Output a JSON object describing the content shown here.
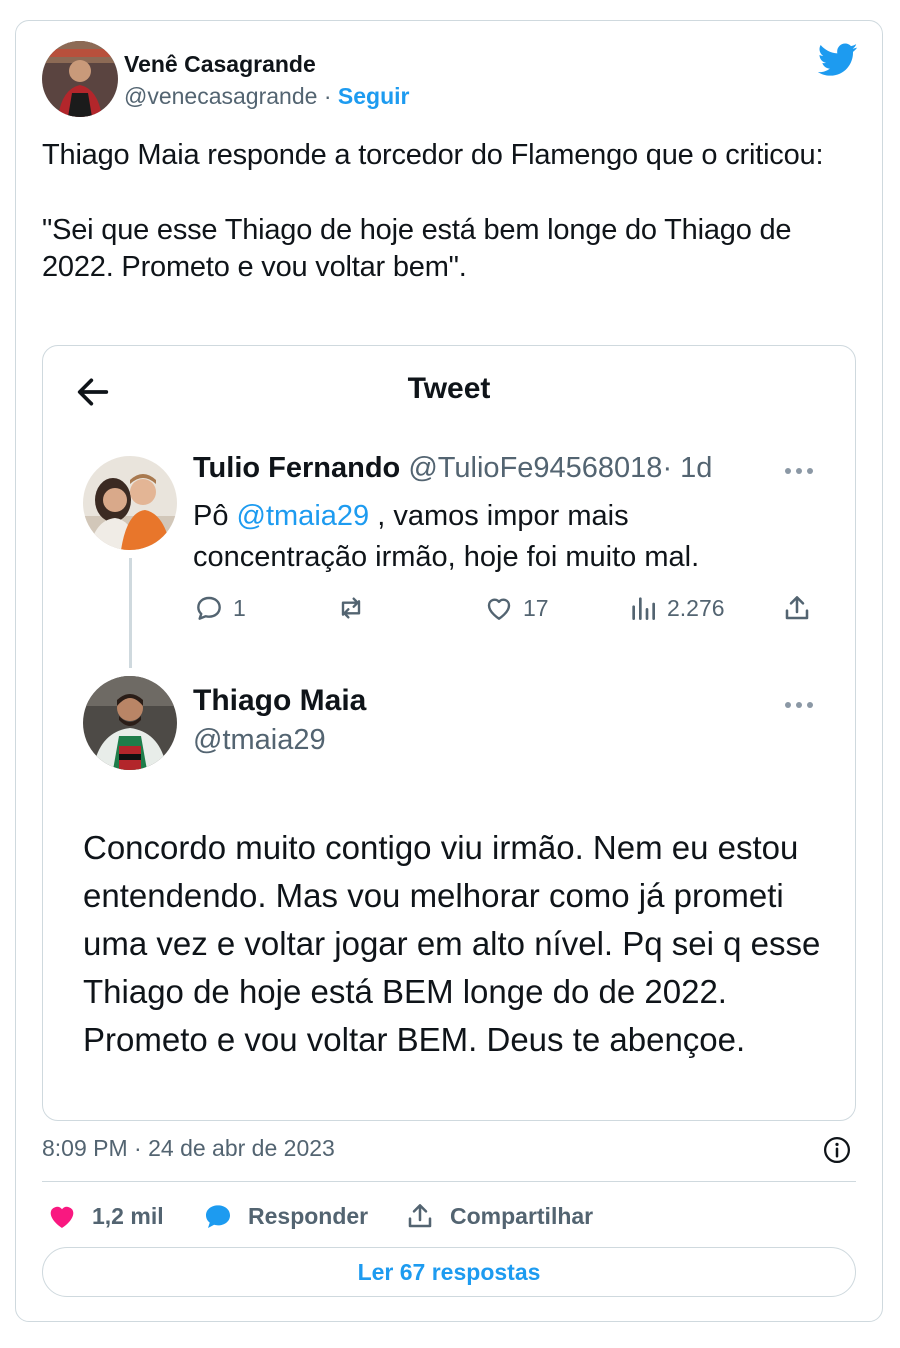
{
  "author": {
    "name": "Venê Casagrande",
    "handle": "@venecasagrande",
    "separator": "·",
    "follow_label": "Seguir"
  },
  "tweet": {
    "paragraphs": [
      "Thiago Maia responde a torcedor do Flamengo que o criticou:",
      "\"Sei que esse Thiago de hoje está bem longe do Thiago de 2022. Prometo e vou voltar bem\"."
    ]
  },
  "embed": {
    "title": "Tweet",
    "reply_tweet": {
      "name": "Tulio Fernando",
      "handle": "@TulioFe94568018",
      "time": "· 1d",
      "text_before": "Pô ",
      "mention": "@tmaia29",
      "text_after": " , vamos impor mais concentração irmão,  hoje foi muito mal.",
      "stats": {
        "replies": "1",
        "retweets": "",
        "likes": "17",
        "views": "2.276"
      }
    },
    "main_tweet": {
      "name": "Thiago Maia",
      "handle": "@tmaia29",
      "text": "Concordo muito contigo viu irmão. Nem eu estou entendendo. Mas vou melhorar como já prometi uma vez e voltar jogar em alto nível. Pq sei q esse Thiago de hoje está BEM longe do de 2022. Prometo e vou voltar BEM. Deus te abençoe."
    }
  },
  "timestamp": "8:09 PM · 24 de abr de 2023",
  "bottom_actions": {
    "likes": "1,2 mil",
    "reply": "Responder",
    "share": "Compartilhar"
  },
  "read_replies": "Ler 67 respostas",
  "colors": {
    "accent": "#1d9bf0",
    "like": "#f91880",
    "muted": "#536471",
    "border": "#cfd9de"
  }
}
